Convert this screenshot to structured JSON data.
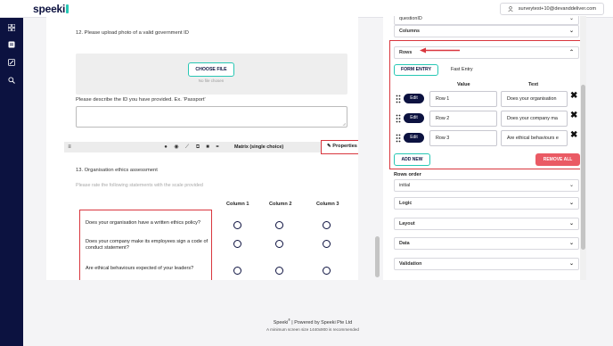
{
  "app": {
    "logo": "speeki"
  },
  "header": {
    "user_email": "surveytest+10@devanddeliver.com"
  },
  "sidebar": {
    "items": [
      "grid-icon",
      "survey-icon",
      "edit-icon",
      "search-icon"
    ]
  },
  "editor": {
    "q12": {
      "title": "12.  Please upload photo of a valid government ID",
      "choose_file": "CHOOSE FILE",
      "no_file": "No file chosen",
      "describe_label": "Please describe the ID you have provided. Ex. 'Passport'"
    },
    "toolbar": {
      "title": "Matrix (single choice)",
      "properties": "Properties"
    },
    "q13": {
      "title": "13.  Organisation ethics assessment",
      "subtitle": "Please rate the following statements with the scale provided",
      "columns": [
        "Column 1",
        "Column 2",
        "Column 3"
      ],
      "rows": [
        "Does your organisation have a written ethics policy?",
        "Does your company make its employees sign a code of conduct statement?",
        "Are ethical behaviours expected of your leaders?"
      ]
    }
  },
  "footer": {
    "line1": "Speeki",
    "tm": "®",
    "line1b": " | Powered by Speeki Pte Ltd",
    "line2": "A minimum screen size 1440x900 is recommended"
  },
  "properties": {
    "top_select": "questionID",
    "columns_label": "Columns",
    "rows_label": "Rows",
    "tabs": {
      "form_entry": "FORM ENTRY",
      "fast_entry": "Fast Entry"
    },
    "headers": {
      "value": "Value",
      "text": "Text"
    },
    "edit_label": "Edit",
    "rows": [
      {
        "value": "Row 1",
        "text": "Does your organisation"
      },
      {
        "value": "Row 2",
        "text": "Does your company ma"
      },
      {
        "value": "Row 3",
        "text": "Are ethical behaviours e"
      }
    ],
    "add_new": "ADD NEW",
    "remove_all": "REMOVE ALL",
    "rows_order_label": "Rows order",
    "rows_order_value": "initial",
    "sections": [
      "Logic",
      "Layout",
      "Data",
      "Validation"
    ]
  },
  "colors": {
    "brand_navy": "#0c1240",
    "brand_teal": "#27c7b4",
    "highlight_red": "#d9363e",
    "remove_red": "#ea5a64"
  }
}
